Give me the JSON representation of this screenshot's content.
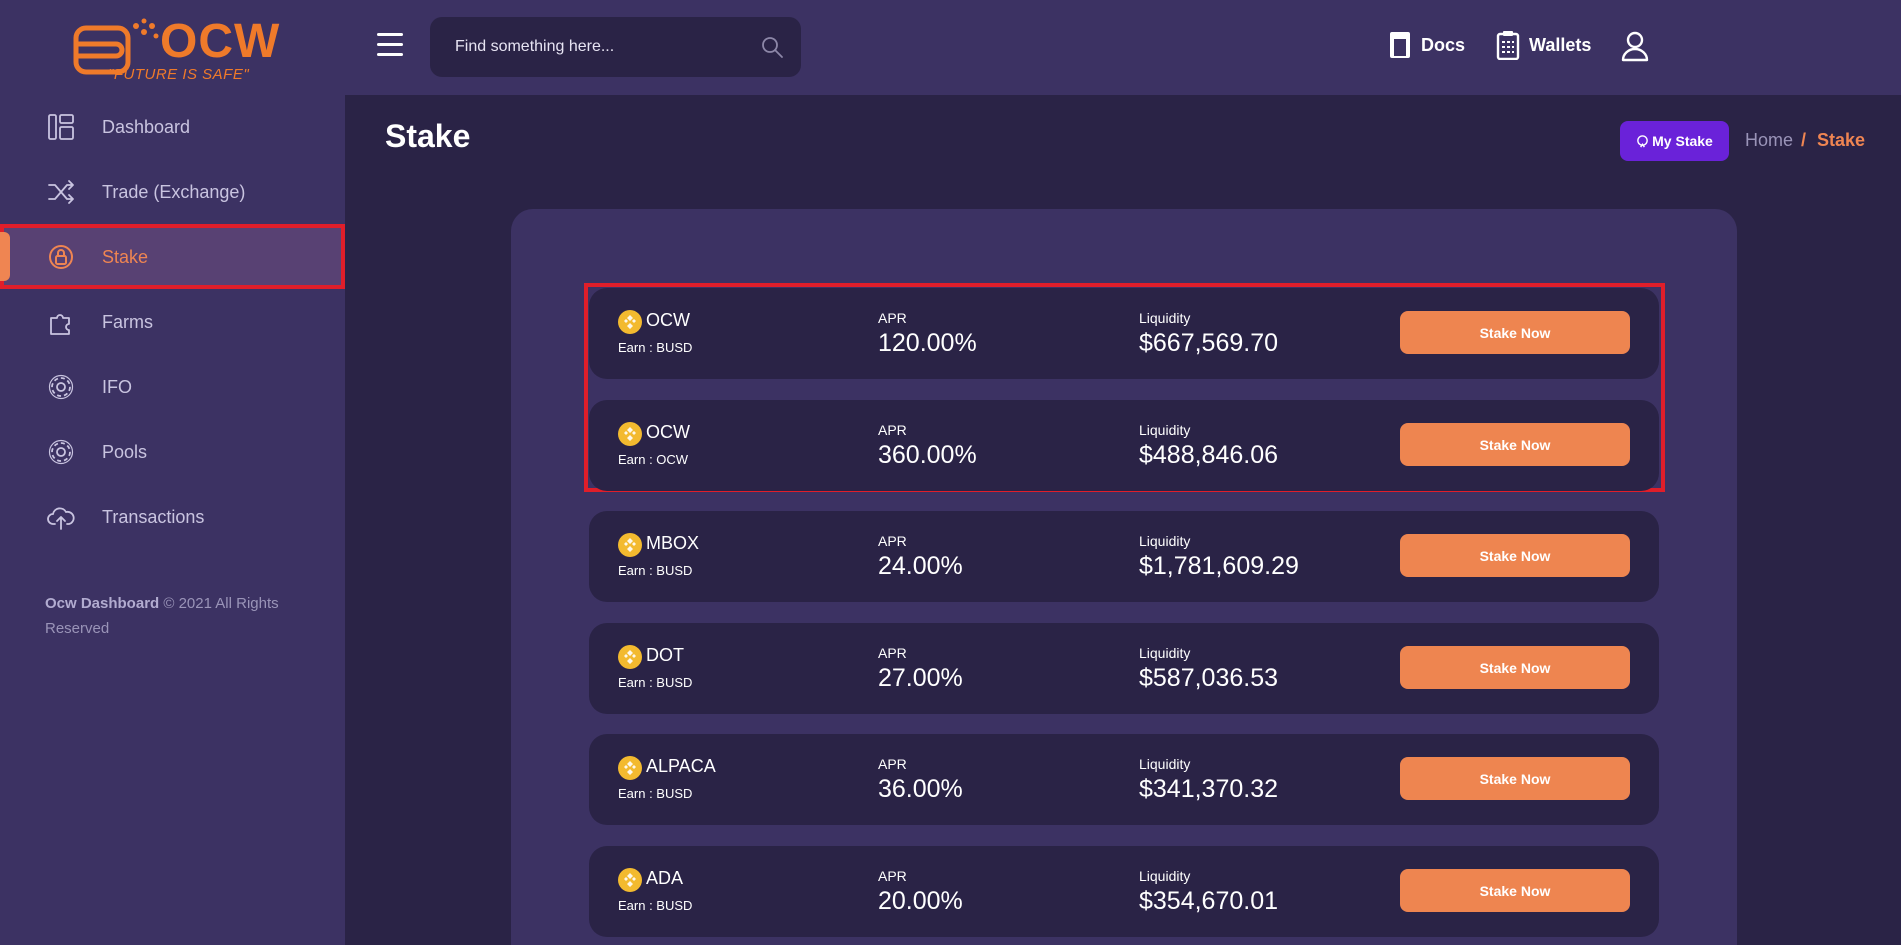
{
  "brand": {
    "name": "OCW",
    "tagline": "\"FUTURE IS SAFE\""
  },
  "sidebar": {
    "items": [
      {
        "label": "Dashboard",
        "icon": "dashboard-icon"
      },
      {
        "label": "Trade (Exchange)",
        "icon": "shuffle-icon"
      },
      {
        "label": "Stake",
        "icon": "stake-icon",
        "active": true
      },
      {
        "label": "Farms",
        "icon": "puzzle-icon"
      },
      {
        "label": "IFO",
        "icon": "gear-icon"
      },
      {
        "label": "Pools",
        "icon": "gear-icon"
      },
      {
        "label": "Transactions",
        "icon": "cloud-upload-icon"
      }
    ],
    "footer_brand": "Ocw Dashboard",
    "footer_text": " © 2021 All Rights Reserved"
  },
  "header": {
    "search_placeholder": "Find something here...",
    "docs_label": "Docs",
    "wallets_label": "Wallets"
  },
  "page": {
    "title": "Stake",
    "my_stake_label": "My Stake",
    "breadcrumb": {
      "home": "Home",
      "separator": "/",
      "current": "Stake"
    }
  },
  "pools": [
    {
      "token": "OCW",
      "earn": "Earn : BUSD",
      "apr_label": "APR",
      "apr": "120.00%",
      "liquidity_label": "Liquidity",
      "liquidity": "$667,569.70",
      "button": "Stake Now"
    },
    {
      "token": "OCW",
      "earn": "Earn : OCW",
      "apr_label": "APR",
      "apr": "360.00%",
      "liquidity_label": "Liquidity",
      "liquidity": "$488,846.06",
      "button": "Stake Now"
    },
    {
      "token": "MBOX",
      "earn": "Earn : BUSD",
      "apr_label": "APR",
      "apr": "24.00%",
      "liquidity_label": "Liquidity",
      "liquidity": "$1,781,609.29",
      "button": "Stake Now"
    },
    {
      "token": "DOT",
      "earn": "Earn : BUSD",
      "apr_label": "APR",
      "apr": "27.00%",
      "liquidity_label": "Liquidity",
      "liquidity": "$587,036.53",
      "button": "Stake Now"
    },
    {
      "token": "ALPACA",
      "earn": "Earn : BUSD",
      "apr_label": "APR",
      "apr": "36.00%",
      "liquidity_label": "Liquidity",
      "liquidity": "$341,370.32",
      "button": "Stake Now"
    },
    {
      "token": "ADA",
      "earn": "Earn : BUSD",
      "apr_label": "APR",
      "apr": "20.00%",
      "liquidity_label": "Liquidity",
      "liquidity": "$354,670.01",
      "button": "Stake Now"
    }
  ],
  "colors": {
    "accent": "#ee8550",
    "highlight": "#e01e2a",
    "purple_button": "#6a22d9",
    "coin": "#f3ba2f"
  }
}
